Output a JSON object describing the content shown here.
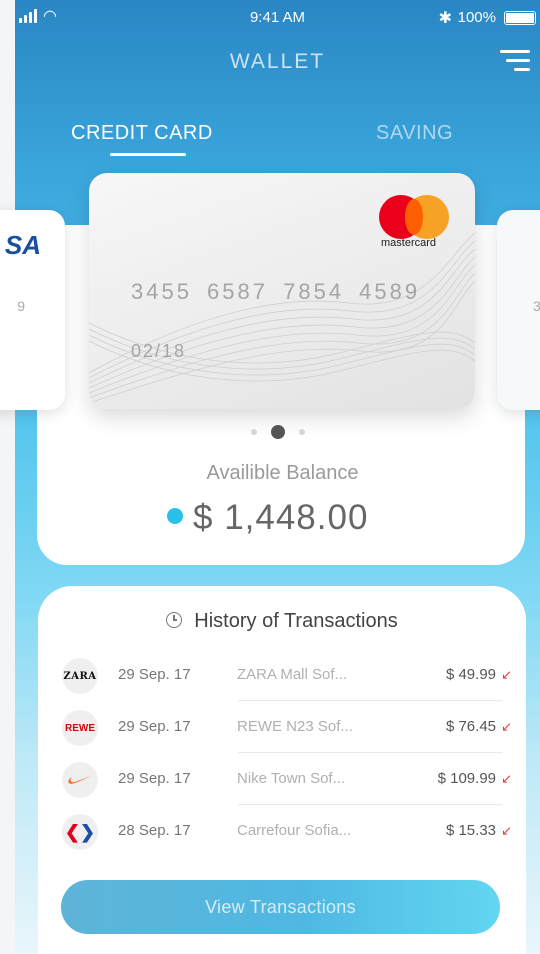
{
  "status_bar": {
    "time": "9:41 AM",
    "battery": "100%"
  },
  "header": {
    "title": "WALLET",
    "menu_icon": "hamburger-menu-icon"
  },
  "tabs": [
    {
      "label": "CREDIT CARD",
      "active": true
    },
    {
      "label": "SAVING",
      "active": false
    }
  ],
  "cards": {
    "left_brand": "SA",
    "left_num": "9",
    "right_num": "3",
    "main": {
      "brand": "mastercard",
      "number": "3455 6587 7854 4589",
      "expiry": "02/18"
    },
    "pager": {
      "count": 3,
      "active_index": 1
    }
  },
  "balance": {
    "label": "Availible Balance",
    "amount": "$ 1,448.00",
    "dot_color": "#27c1ea"
  },
  "history": {
    "title": "History of Transactions",
    "title_icon": "clock-icon",
    "transactions": [
      {
        "logo": "ZARA",
        "logo_icon": "zara-logo-icon",
        "date": "29 Sep. 17",
        "merchant": "ZARA Mall Sof...",
        "amount": "$ 49.99",
        "direction_icon": "arrow-outgoing-icon"
      },
      {
        "logo": "REWE",
        "logo_icon": "rewe-logo-icon",
        "date": "29 Sep. 17",
        "merchant": "REWE N23 Sof...",
        "amount": "$ 76.45",
        "direction_icon": "arrow-outgoing-icon"
      },
      {
        "logo": "",
        "logo_icon": "nike-logo-icon",
        "date": "29 Sep. 17",
        "merchant": "Nike Town Sof...",
        "amount": "$ 109.99",
        "direction_icon": "arrow-outgoing-icon"
      },
      {
        "logo": "",
        "logo_icon": "carrefour-logo-icon",
        "date": "28 Sep. 17",
        "merchant": "Carrefour Sofia...",
        "amount": "$ 15.33",
        "direction_icon": "arrow-outgoing-icon"
      }
    ]
  },
  "actions": {
    "view_transactions": "View Transactions"
  }
}
